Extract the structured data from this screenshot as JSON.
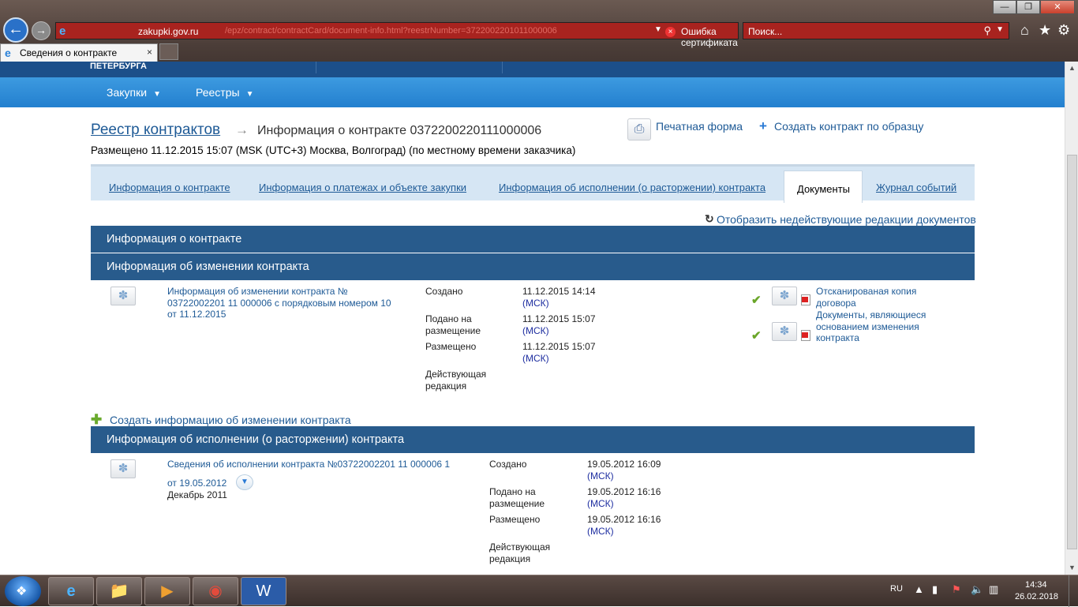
{
  "browser": {
    "window_controls": {
      "minimize": "—",
      "maximize": "❐",
      "close": "✕"
    },
    "address": {
      "host": "zakupki.gov.ru",
      "path": "/epz/contract/contractCard/document-info.html?reestrNumber=3722002201011000006",
      "cert_error": "Ошибка сертификата"
    },
    "search": {
      "placeholder": "Поиск..."
    },
    "tab": {
      "label": "Сведения о контракте"
    }
  },
  "site": {
    "top_band_text": "ПЕТЕРБУРГА",
    "menu": [
      {
        "label": "Закупки"
      },
      {
        "label": "Реестры"
      }
    ]
  },
  "page": {
    "breadcrumb_root": "Реестр контрактов",
    "title": "Информация о контракте 0372200220111000006",
    "placed_line": "Размещено 11.12.2015 15:07 (MSK (UTC+3) Москва, Волгоград) (по местному времени заказчика)",
    "print_form": "Печатная форма",
    "create_by_template": "Создать контракт по образцу",
    "tabs": [
      {
        "label": "Информация о контракте"
      },
      {
        "label": "Информация о платежах и объекте закупки"
      },
      {
        "label": "Информация об исполнении (о расторжении) контракта"
      },
      {
        "label": "Документы",
        "active": true
      },
      {
        "label": "Журнал событий"
      }
    ],
    "show_inactive": "Отобразить недействующие редакции документов",
    "sections": {
      "contract_info": "Информация о контракте",
      "change_info": "Информация об изменении контракта",
      "execution_info": "Информация об исполнении (о расторжении) контракта"
    },
    "change_doc": {
      "title_lines": [
        "Информация об изменении контракта №",
        "03722002201 11 000006 с порядковым номером 10",
        "от 11.12.2015"
      ],
      "created_label": "Создано",
      "created_value": "11.12.2015 14:14",
      "submitted_label_lines": [
        "Подано на",
        "размещение"
      ],
      "submitted_value": "11.12.2015 15:07",
      "placed_label": "Размещено",
      "placed_value": "11.12.2015 15:07",
      "tz": "(МСК)",
      "current_label_lines": [
        "Действующая",
        "редакция"
      ],
      "attachments": [
        {
          "lines": [
            "Отсканированая копия",
            "договора"
          ]
        },
        {
          "lines": [
            "Документы, являющиеся",
            "основанием изменения",
            "контракта"
          ]
        }
      ]
    },
    "add_change_link": "Создать информацию об изменении контракта",
    "exec_doc": {
      "title_line1": "Сведения об исполнении контракта №03722002201 11 000006 1",
      "title_line2": "от 19.05.2012",
      "subtitle": "Декабрь 2011",
      "created_label": "Создано",
      "created_value": "19.05.2012 16:09",
      "submitted_label_lines": [
        "Подано на",
        "размещение"
      ],
      "submitted_value": "19.05.2012 16:16",
      "placed_label": "Размещено",
      "placed_value": "19.05.2012 16:16",
      "tz": "(МСК)",
      "current_label_lines": [
        "Действующая",
        "редакция"
      ]
    }
  },
  "taskbar": {
    "lang": "RU",
    "time": "14:34",
    "date": "26.02.2018"
  }
}
